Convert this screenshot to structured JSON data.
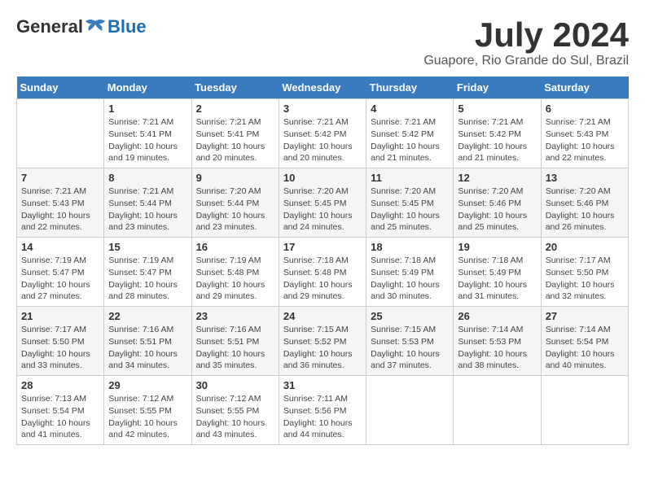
{
  "header": {
    "logo_general": "General",
    "logo_blue": "Blue",
    "month_year": "July 2024",
    "location": "Guapore, Rio Grande do Sul, Brazil"
  },
  "weekdays": [
    "Sunday",
    "Monday",
    "Tuesday",
    "Wednesday",
    "Thursday",
    "Friday",
    "Saturday"
  ],
  "weeks": [
    [
      null,
      {
        "day": "1",
        "sunrise": "7:21 AM",
        "sunset": "5:41 PM",
        "daylight": "10 hours and 19 minutes."
      },
      {
        "day": "2",
        "sunrise": "7:21 AM",
        "sunset": "5:41 PM",
        "daylight": "10 hours and 20 minutes."
      },
      {
        "day": "3",
        "sunrise": "7:21 AM",
        "sunset": "5:42 PM",
        "daylight": "10 hours and 20 minutes."
      },
      {
        "day": "4",
        "sunrise": "7:21 AM",
        "sunset": "5:42 PM",
        "daylight": "10 hours and 21 minutes."
      },
      {
        "day": "5",
        "sunrise": "7:21 AM",
        "sunset": "5:42 PM",
        "daylight": "10 hours and 21 minutes."
      },
      {
        "day": "6",
        "sunrise": "7:21 AM",
        "sunset": "5:43 PM",
        "daylight": "10 hours and 22 minutes."
      }
    ],
    [
      {
        "day": "7",
        "sunrise": "7:21 AM",
        "sunset": "5:43 PM",
        "daylight": "10 hours and 22 minutes."
      },
      {
        "day": "8",
        "sunrise": "7:21 AM",
        "sunset": "5:44 PM",
        "daylight": "10 hours and 23 minutes."
      },
      {
        "day": "9",
        "sunrise": "7:20 AM",
        "sunset": "5:44 PM",
        "daylight": "10 hours and 23 minutes."
      },
      {
        "day": "10",
        "sunrise": "7:20 AM",
        "sunset": "5:45 PM",
        "daylight": "10 hours and 24 minutes."
      },
      {
        "day": "11",
        "sunrise": "7:20 AM",
        "sunset": "5:45 PM",
        "daylight": "10 hours and 25 minutes."
      },
      {
        "day": "12",
        "sunrise": "7:20 AM",
        "sunset": "5:46 PM",
        "daylight": "10 hours and 25 minutes."
      },
      {
        "day": "13",
        "sunrise": "7:20 AM",
        "sunset": "5:46 PM",
        "daylight": "10 hours and 26 minutes."
      }
    ],
    [
      {
        "day": "14",
        "sunrise": "7:19 AM",
        "sunset": "5:47 PM",
        "daylight": "10 hours and 27 minutes."
      },
      {
        "day": "15",
        "sunrise": "7:19 AM",
        "sunset": "5:47 PM",
        "daylight": "10 hours and 28 minutes."
      },
      {
        "day": "16",
        "sunrise": "7:19 AM",
        "sunset": "5:48 PM",
        "daylight": "10 hours and 29 minutes."
      },
      {
        "day": "17",
        "sunrise": "7:18 AM",
        "sunset": "5:48 PM",
        "daylight": "10 hours and 29 minutes."
      },
      {
        "day": "18",
        "sunrise": "7:18 AM",
        "sunset": "5:49 PM",
        "daylight": "10 hours and 30 minutes."
      },
      {
        "day": "19",
        "sunrise": "7:18 AM",
        "sunset": "5:49 PM",
        "daylight": "10 hours and 31 minutes."
      },
      {
        "day": "20",
        "sunrise": "7:17 AM",
        "sunset": "5:50 PM",
        "daylight": "10 hours and 32 minutes."
      }
    ],
    [
      {
        "day": "21",
        "sunrise": "7:17 AM",
        "sunset": "5:50 PM",
        "daylight": "10 hours and 33 minutes."
      },
      {
        "day": "22",
        "sunrise": "7:16 AM",
        "sunset": "5:51 PM",
        "daylight": "10 hours and 34 minutes."
      },
      {
        "day": "23",
        "sunrise": "7:16 AM",
        "sunset": "5:51 PM",
        "daylight": "10 hours and 35 minutes."
      },
      {
        "day": "24",
        "sunrise": "7:15 AM",
        "sunset": "5:52 PM",
        "daylight": "10 hours and 36 minutes."
      },
      {
        "day": "25",
        "sunrise": "7:15 AM",
        "sunset": "5:53 PM",
        "daylight": "10 hours and 37 minutes."
      },
      {
        "day": "26",
        "sunrise": "7:14 AM",
        "sunset": "5:53 PM",
        "daylight": "10 hours and 38 minutes."
      },
      {
        "day": "27",
        "sunrise": "7:14 AM",
        "sunset": "5:54 PM",
        "daylight": "10 hours and 40 minutes."
      }
    ],
    [
      {
        "day": "28",
        "sunrise": "7:13 AM",
        "sunset": "5:54 PM",
        "daylight": "10 hours and 41 minutes."
      },
      {
        "day": "29",
        "sunrise": "7:12 AM",
        "sunset": "5:55 PM",
        "daylight": "10 hours and 42 minutes."
      },
      {
        "day": "30",
        "sunrise": "7:12 AM",
        "sunset": "5:55 PM",
        "daylight": "10 hours and 43 minutes."
      },
      {
        "day": "31",
        "sunrise": "7:11 AM",
        "sunset": "5:56 PM",
        "daylight": "10 hours and 44 minutes."
      },
      null,
      null,
      null
    ]
  ],
  "labels": {
    "sunrise": "Sunrise:",
    "sunset": "Sunset:",
    "daylight": "Daylight:"
  }
}
